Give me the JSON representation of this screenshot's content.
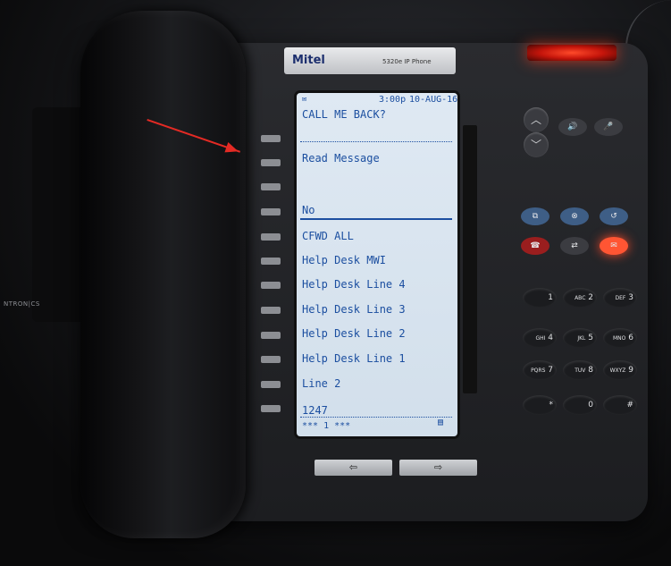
{
  "phone": {
    "brand": "Mitel",
    "model": "5320e IP Phone",
    "side_brand": "NTRON|CS"
  },
  "screen": {
    "time": "3:00p",
    "date": "10-AUG-16",
    "title": "CALL ME BACK?",
    "option1": "Read Message",
    "option2": "No",
    "lines": [
      "CFWD ALL",
      "Help Desk MWI",
      "Help Desk Line 4",
      "Help Desk Line 3",
      "Help Desk Line 2",
      "Help Desk Line 1",
      "Line 2",
      "1247"
    ],
    "footer": "*** 1 ***"
  },
  "keypad": [
    "1",
    "2",
    "3",
    "4",
    "5",
    "6",
    "7",
    "8",
    "9",
    "*",
    "0",
    "#"
  ],
  "keypad_letters": [
    "",
    "ABC",
    "DEF",
    "GHI",
    "JKL",
    "MNO",
    "PQRS",
    "TUV",
    "WXYZ",
    "",
    "",
    ""
  ],
  "icons": {
    "volume": "speaker-icon",
    "mute": "microphone-icon",
    "hold": "hold-icon",
    "cancel": "cancel-icon",
    "redial": "redial-icon",
    "goodbye": "hang-up-icon",
    "transfer": "transfer-icon",
    "message": "message-icon"
  },
  "colors": {
    "screen_text": "#1c4fa0",
    "indicator": "#ff4a2a",
    "annotation_arrow": "#e42a24"
  }
}
